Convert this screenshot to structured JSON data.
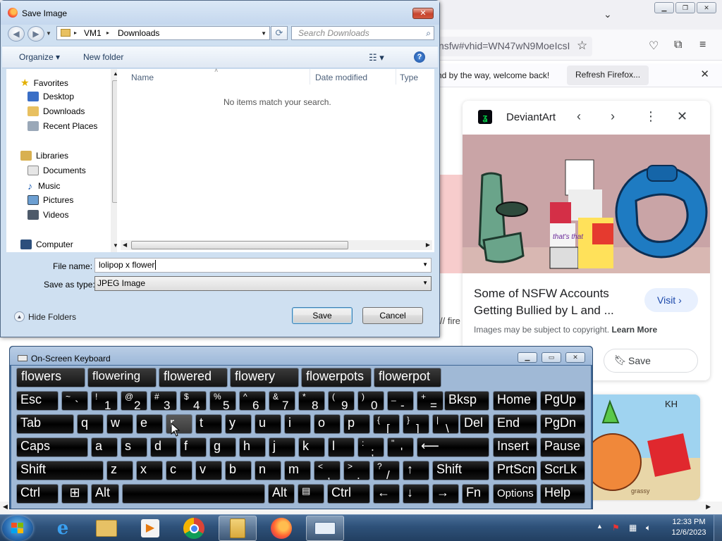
{
  "browser": {
    "url_fragment": "nsfw#vhid=WN47wN9MoeIcsI",
    "notification_text": "nd by the way, welcome back!",
    "refresh_label": "Refresh Firefox...",
    "left_fragment": "// fire"
  },
  "lens_card": {
    "site": "DeviantArt",
    "caption": "Some of NSFW Accounts Getting Bullied by L and ...",
    "visit_label": "Visit",
    "copyright_text": "Images may be subject to copyright.",
    "learn_more": "Learn More",
    "save_label": "Save",
    "image_bubble_text": "that's that"
  },
  "second_card": {
    "corner_text": "KH",
    "image_text": "grassy"
  },
  "dialog": {
    "title": "Save Image",
    "breadcrumb": [
      "VM1",
      "Downloads"
    ],
    "search_placeholder": "Search Downloads",
    "toolbar": {
      "organize": "Organize",
      "new_folder": "New folder"
    },
    "nav": {
      "favorites_header": "Favorites",
      "favorites": [
        "Desktop",
        "Downloads",
        "Recent Places"
      ],
      "libraries_header": "Libraries",
      "libraries": [
        "Documents",
        "Music",
        "Pictures",
        "Videos"
      ],
      "computer": "Computer"
    },
    "columns": [
      "Name",
      "Date modified",
      "Type"
    ],
    "empty_message": "No items match your search.",
    "file_name_label": "File name:",
    "file_name_value": "lolipop x flower",
    "save_type_label": "Save as type:",
    "save_type_value": "JPEG Image",
    "hide_folders": "Hide Folders",
    "save_button": "Save",
    "cancel_button": "Cancel"
  },
  "osk": {
    "title": "On-Screen Keyboard",
    "suggestions": [
      "flowers",
      "flowering",
      "flowered",
      "flowery",
      "flowerpots",
      "flowerpot"
    ],
    "keys": {
      "esc": "Esc",
      "bksp": "Bksp",
      "home": "Home",
      "pgup": "PgUp",
      "tab": "Tab",
      "del": "Del",
      "end": "End",
      "pgdn": "PgDn",
      "caps": "Caps",
      "insert": "Insert",
      "pause": "Pause",
      "shift": "Shift",
      "prtscn": "PrtScn",
      "scrlk": "ScrLk",
      "ctrl": "Ctrl",
      "alt": "Alt",
      "fn": "Fn",
      "options": "Options",
      "help": "Help",
      "num": [
        [
          "~",
          "`"
        ],
        [
          "!",
          "1"
        ],
        [
          "@",
          "2"
        ],
        [
          "#",
          "3"
        ],
        [
          "$",
          "4"
        ],
        [
          "%",
          "5"
        ],
        [
          "^",
          "6"
        ],
        [
          "&",
          "7"
        ],
        [
          "*",
          "8"
        ],
        [
          "(",
          "9"
        ],
        [
          ")",
          "0"
        ],
        [
          "_",
          "-"
        ],
        [
          "+",
          "="
        ]
      ],
      "row_q": [
        "q",
        "w",
        "e",
        "r",
        "t",
        "y",
        "u",
        "i",
        "o",
        "p"
      ],
      "row_q_extra": [
        [
          "{",
          "["
        ],
        [
          "}",
          "]"
        ],
        [
          "|",
          "\\"
        ]
      ],
      "row_a": [
        "a",
        "s",
        "d",
        "f",
        "g",
        "h",
        "j",
        "k",
        "l"
      ],
      "row_a_extra": [
        [
          ":",
          ";"
        ],
        [
          "\"",
          "'"
        ]
      ],
      "row_z": [
        "z",
        "x",
        "c",
        "v",
        "b",
        "n",
        "m"
      ],
      "row_z_extra": [
        [
          "<",
          ","
        ],
        [
          ">",
          "."
        ],
        [
          "?",
          "/"
        ]
      ],
      "arrows": {
        "up": "↑",
        "left": "←",
        "down": "↓",
        "right": "→"
      },
      "enter_symbol": "⟵"
    }
  },
  "taskbar": {
    "time": "12:33 PM",
    "date": "12/6/2023"
  }
}
